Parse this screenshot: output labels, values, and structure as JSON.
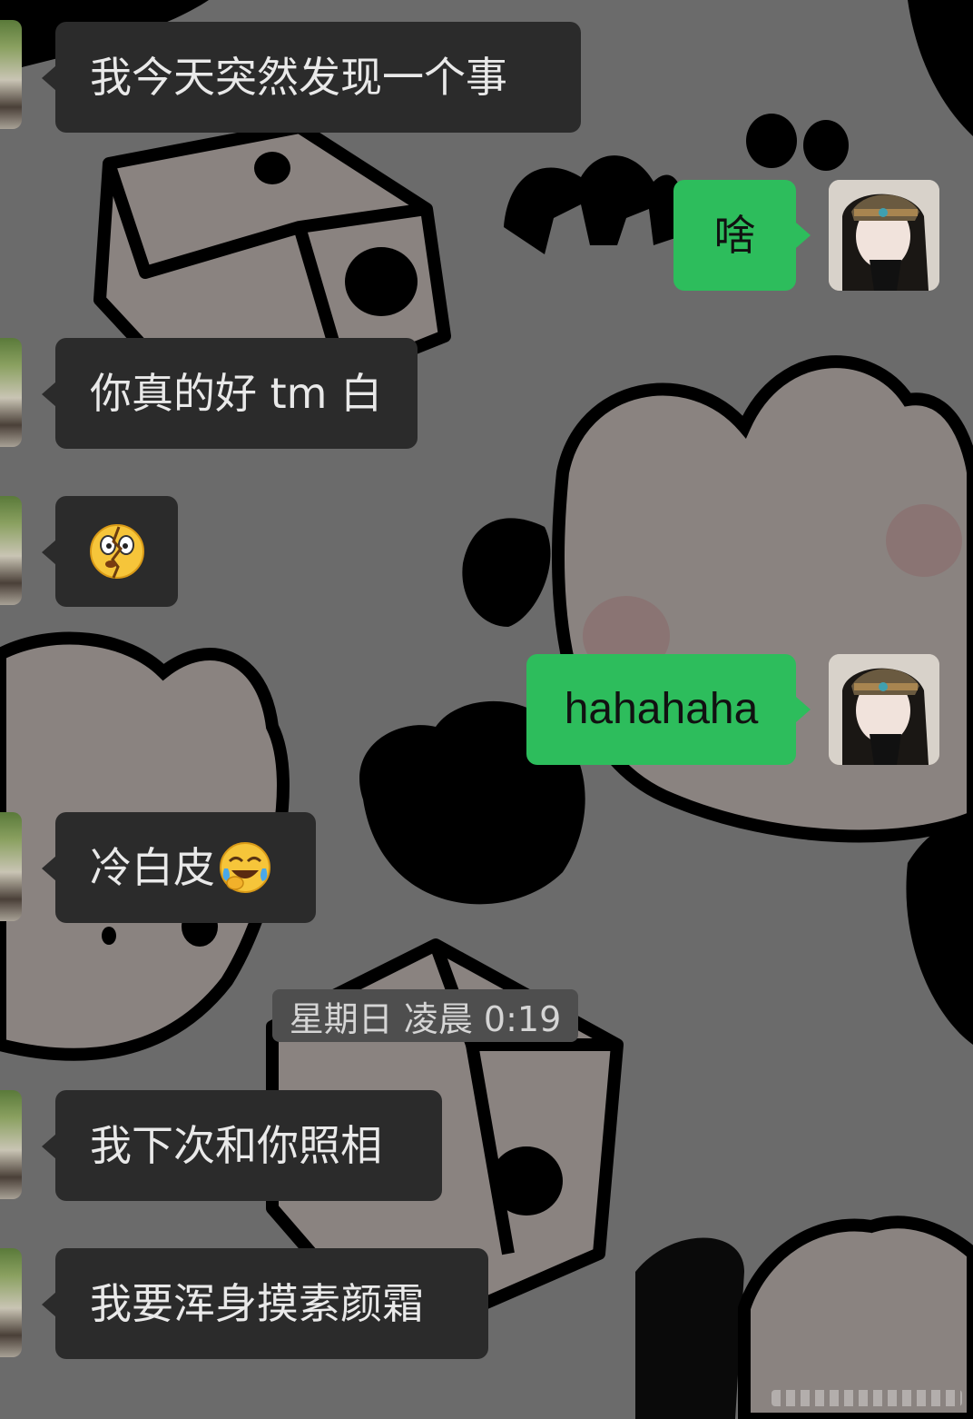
{
  "chat": {
    "messages": [
      {
        "side": "left",
        "text": "我今天突然发现一个事"
      },
      {
        "side": "right",
        "text": "啥"
      },
      {
        "side": "left",
        "text": "你真的好 tm 白"
      },
      {
        "side": "left",
        "text": "",
        "emoji": "broken-heart-shocked-face-emoji"
      },
      {
        "side": "right",
        "text": "hahahaha"
      },
      {
        "side": "left",
        "text": "冷白皮",
        "emoji": "face-with-tears-of-joy-emoji"
      },
      {
        "side": "left",
        "text": "我下次和你照相"
      },
      {
        "side": "left",
        "text": "我要浑身摸素颜霜"
      }
    ],
    "timestamp": "星期日 凌晨 0:19"
  },
  "colors": {
    "background": "#6b6b6b",
    "incoming_bubble": "#2b2b2b",
    "outgoing_bubble": "#2dbd5c",
    "incoming_text": "#e9e9e9",
    "outgoing_text": "#111111"
  }
}
